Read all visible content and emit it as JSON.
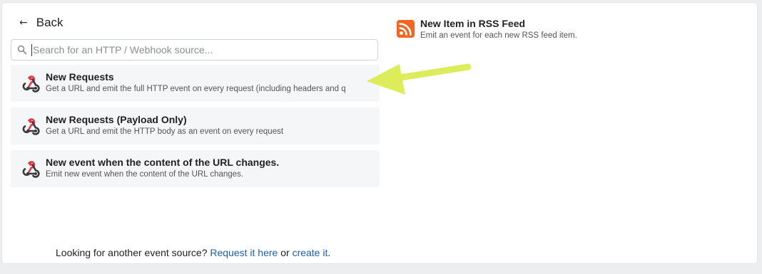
{
  "header": {
    "back_label": "Back",
    "back_icon": "arrow-left-icon"
  },
  "search": {
    "placeholder": "Search for an HTTP / Webhook source..."
  },
  "sources": [
    {
      "title": "New Requests",
      "description": "Get a URL and emit the full HTTP event on every request (including headers and q",
      "icon": "webhook-icon"
    },
    {
      "title": "New Requests (Payload Only)",
      "description": "Get a URL and emit the HTTP body as an event on every request",
      "icon": "webhook-icon"
    },
    {
      "title": "New event when the content of the URL changes.",
      "description": "Emit new event when the content of the URL changes.",
      "icon": "webhook-icon"
    }
  ],
  "rss": {
    "title": "New Item in RSS Feed",
    "description": "Emit an event for each new RSS feed item.",
    "icon": "rss-icon"
  },
  "footer": {
    "prefix": "Looking for another event source?",
    "request_link": "Request it here",
    "middle": "or",
    "create_link": "create it",
    "suffix": "."
  },
  "colors": {
    "webhook_red": "#e03a4a",
    "webhook_dark": "#3a3a3a",
    "rss_orange": "#f26522",
    "link_blue": "#1a5fb4",
    "annotation_arrow": "#dcec5a"
  }
}
